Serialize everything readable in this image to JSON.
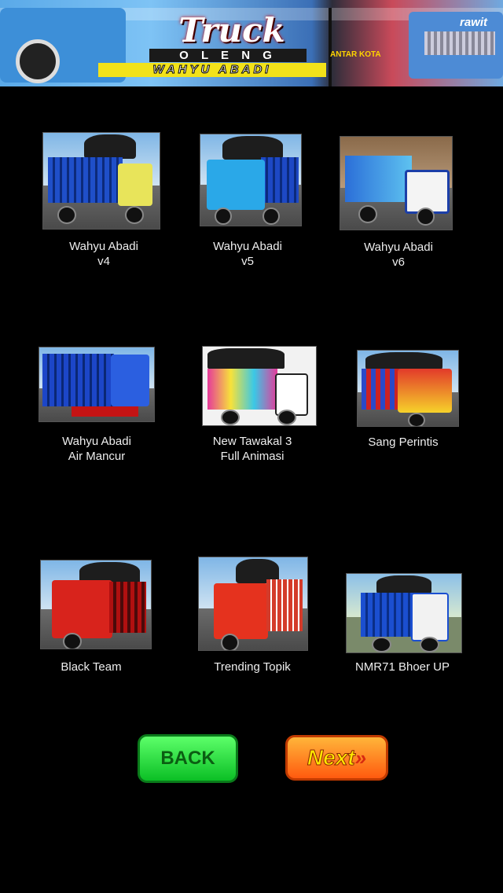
{
  "banner": {
    "title": "Truck",
    "subtitle": "O L E N G",
    "brand": "WAHYU ABADI",
    "tag_left": "ANTAR KOTA",
    "tag_right": "rawit"
  },
  "items": [
    {
      "label": "Wahyu Abadi\nv4"
    },
    {
      "label": "Wahyu Abadi\nv5"
    },
    {
      "label": "Wahyu Abadi\nv6"
    },
    {
      "label": "Wahyu Abadi\nAir Mancur"
    },
    {
      "label": "New Tawakal 3\nFull Animasi"
    },
    {
      "label": "Sang Perintis"
    },
    {
      "label": "Black Team"
    },
    {
      "label": "Trending Topik"
    },
    {
      "label": "NMR71 Bhoer UP"
    }
  ],
  "buttons": {
    "back": "BACK",
    "next": "Next",
    "next_arrows": "»"
  },
  "colors": {
    "background": "#000000",
    "back_button": "#22d63a",
    "next_button": "#ff7a1f"
  }
}
